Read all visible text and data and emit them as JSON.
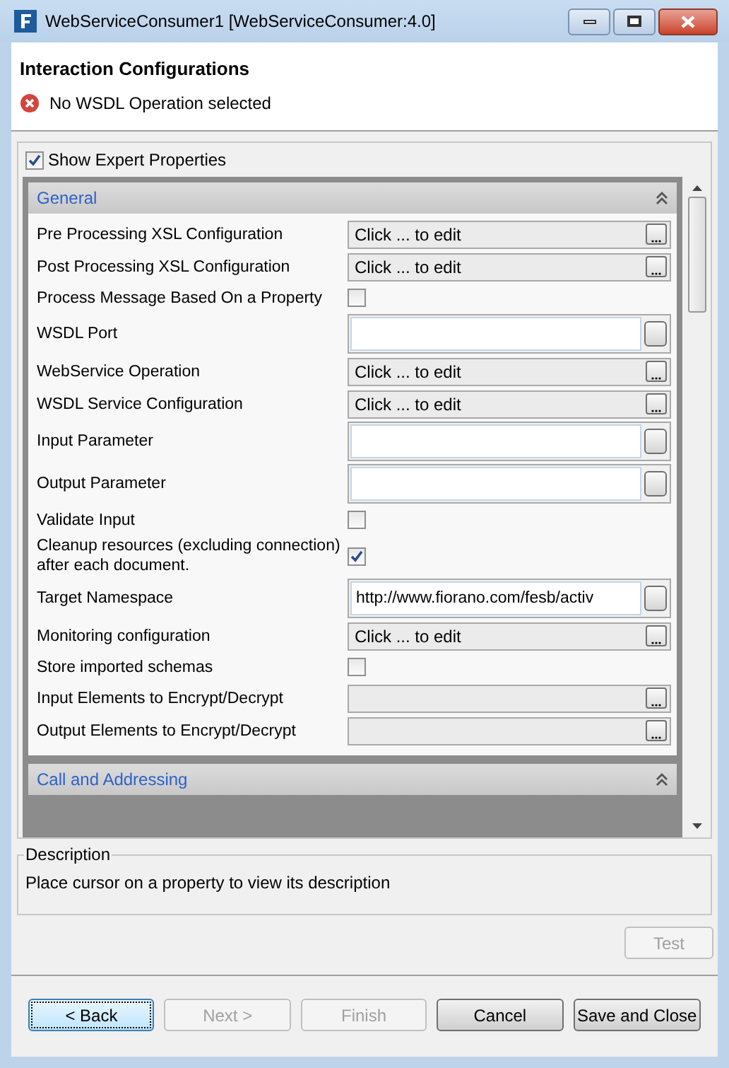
{
  "window": {
    "title": "WebServiceConsumer1 [WebServiceConsumer:4.0]"
  },
  "header": {
    "title": "Interaction Configurations",
    "error": "No WSDL Operation selected"
  },
  "show_expert": {
    "label": "Show Expert Properties",
    "checked": true
  },
  "sections": [
    {
      "title": "General",
      "expanded": true,
      "properties": [
        {
          "label": "Pre Processing XSL Configuration",
          "kind": "editor",
          "value": "Click ... to edit"
        },
        {
          "label": "Post Processing XSL Configuration",
          "kind": "editor",
          "value": "Click ... to edit"
        },
        {
          "label": "Process Message Based On a Property",
          "kind": "checkbox",
          "checked": false
        },
        {
          "label": "WSDL Port",
          "kind": "text"
        },
        {
          "label": "WebService Operation",
          "kind": "editor",
          "value": "Click ... to edit"
        },
        {
          "label": "WSDL Service Configuration",
          "kind": "editor",
          "value": "Click ... to edit"
        },
        {
          "label": "Input Parameter",
          "kind": "text"
        },
        {
          "label": "Output Parameter",
          "kind": "text"
        },
        {
          "label": "Validate Input",
          "kind": "checkbox",
          "checked": false
        },
        {
          "label": "Cleanup resources (excluding connection) after each document.",
          "kind": "checkbox",
          "checked": true
        },
        {
          "label": "Target Namespace",
          "kind": "text",
          "value": "http://www.fiorano.com/fesb/activ"
        },
        {
          "label": "Monitoring configuration",
          "kind": "editor",
          "value": "Click ... to edit"
        },
        {
          "label": "Store imported schemas",
          "kind": "checkbox",
          "checked": false
        },
        {
          "label": "Input Elements to Encrypt/Decrypt",
          "kind": "editor"
        },
        {
          "label": "Output Elements to Encrypt/Decrypt",
          "kind": "editor"
        }
      ]
    },
    {
      "title": "Call and Addressing",
      "expanded": true
    }
  ],
  "description": {
    "title": "Description",
    "text": "Place cursor on a property to view its description"
  },
  "test_button": {
    "label": "Test",
    "disabled": true
  },
  "buttons": [
    {
      "label": "< Back",
      "disabled": false,
      "focused": true
    },
    {
      "label": "Next >",
      "disabled": true,
      "focused": false
    },
    {
      "label": "Finish",
      "disabled": true,
      "focused": false
    },
    {
      "label": "Cancel",
      "disabled": false,
      "focused": false
    },
    {
      "label": "Save and Close",
      "disabled": false,
      "focused": false
    }
  ]
}
